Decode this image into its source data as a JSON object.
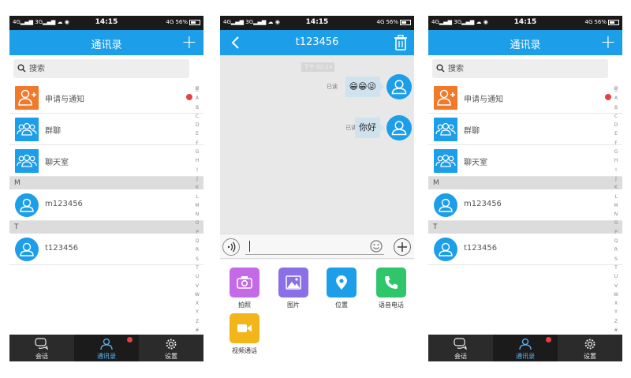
{
  "status": {
    "left": "4G▂▄▆ 3G▂▄▆ ☁ ◉",
    "time": "14:15",
    "net": "4G",
    "battery": "56%"
  },
  "contacts_screen": {
    "title": "通讯录",
    "search_placeholder": "搜索",
    "top_items": [
      {
        "label": "申请与通知",
        "icon": "person-plus-icon",
        "color": "#f07a2a"
      },
      {
        "label": "群聊",
        "icon": "group-icon",
        "color": "#1d9ee8"
      },
      {
        "label": "聊天室",
        "icon": "group-icon",
        "color": "#1d9ee8"
      }
    ],
    "sections": [
      {
        "letter": "M",
        "contacts": [
          "m123456"
        ]
      },
      {
        "letter": "T",
        "contacts": [
          "t123456"
        ]
      }
    ],
    "alphabet": [
      "星",
      "A",
      "B",
      "C",
      "D",
      "E",
      "F",
      "G",
      "H",
      "I",
      "J",
      "K",
      "L",
      "M",
      "N",
      "O",
      "P",
      "Q",
      "R",
      "S",
      "T",
      "U",
      "V",
      "W",
      "X",
      "Y",
      "Z",
      "#"
    ]
  },
  "tabs": [
    {
      "label": "会话",
      "icon": "chat-bubble-icon",
      "active": false
    },
    {
      "label": "通讯录",
      "icon": "contact-icon",
      "active": true
    },
    {
      "label": "设置",
      "icon": "gear-icon",
      "active": false
    }
  ],
  "chat_screen": {
    "title": "t123456",
    "timestamp": "下午 02:14",
    "messages": [
      {
        "text": "😁😁😜",
        "read": "已读"
      },
      {
        "text": "你好",
        "read": "已读"
      }
    ],
    "attachments": [
      {
        "label": "拍照",
        "icon": "camera-icon",
        "color": "#c56ae6"
      },
      {
        "label": "图片",
        "icon": "picture-icon",
        "color": "#8a6fe6"
      },
      {
        "label": "位置",
        "icon": "location-icon",
        "color": "#1d9ee8"
      },
      {
        "label": "语音电话",
        "icon": "phone-icon",
        "color": "#2fc56b"
      },
      {
        "label": "视频通话",
        "icon": "video-icon",
        "color": "#f2b51a"
      }
    ]
  }
}
